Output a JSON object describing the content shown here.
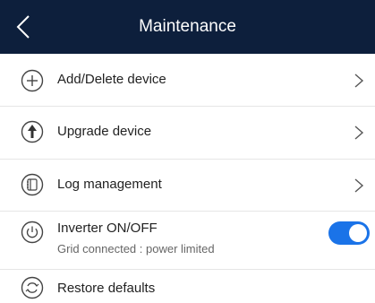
{
  "header": {
    "title": "Maintenance"
  },
  "items": [
    {
      "label": "Add/Delete device",
      "icon": "plus-circle-icon"
    },
    {
      "label": "Upgrade device",
      "icon": "upgrade-arrow-icon"
    },
    {
      "label": "Log management",
      "icon": "log-book-icon"
    },
    {
      "label": "Inverter ON/OFF",
      "sublabel": "Grid connected : power limited",
      "icon": "power-icon",
      "toggle_on": true
    },
    {
      "label": "Restore defaults",
      "icon": "restore-icon"
    }
  ],
  "colors": {
    "header_bg": "#0d1f3c",
    "toggle_on": "#1a73e8"
  }
}
